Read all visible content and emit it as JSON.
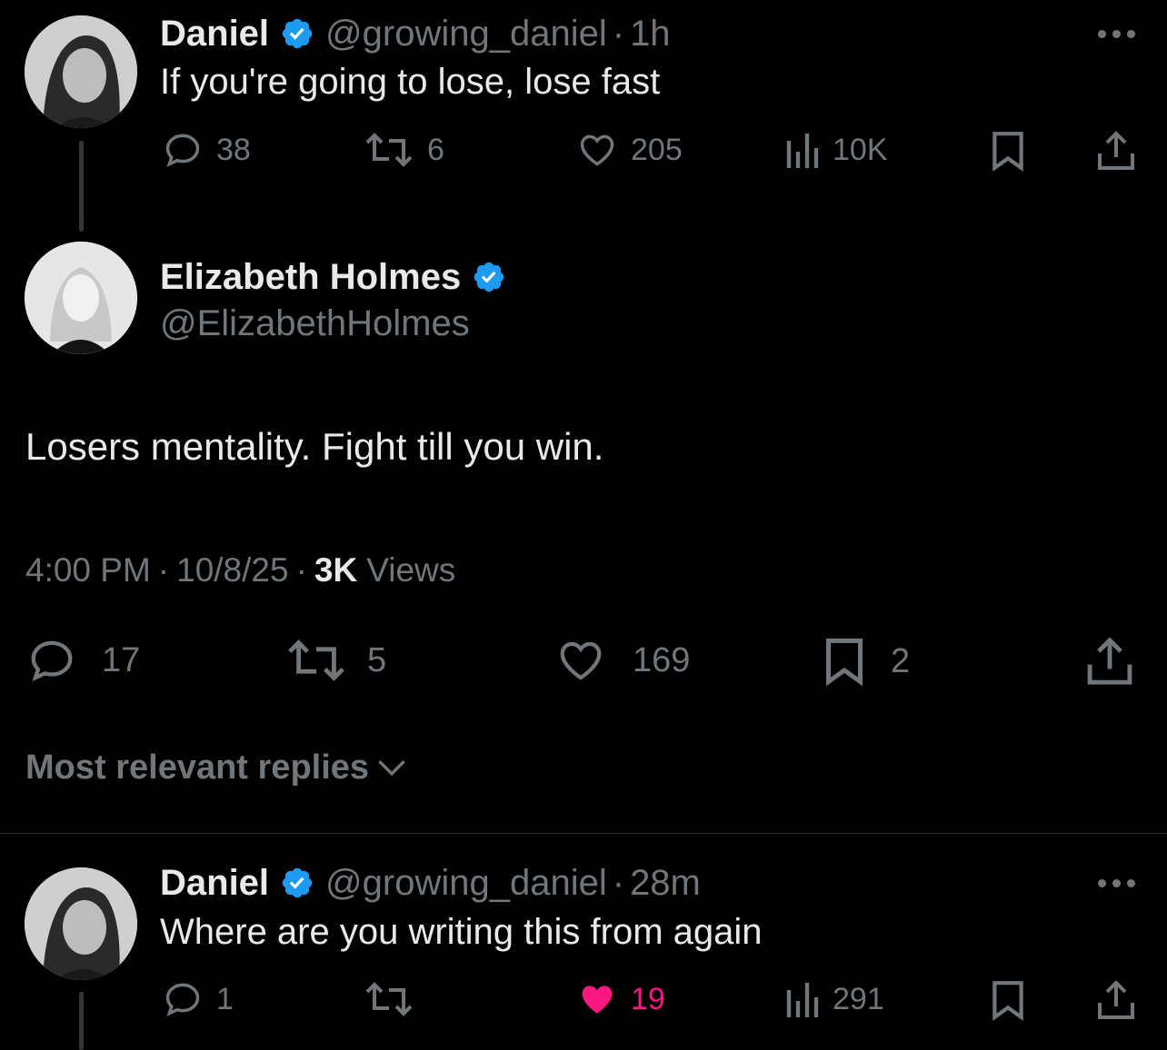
{
  "tweets": [
    {
      "name": "Daniel",
      "handle": "@growing_daniel",
      "sep": "·",
      "time": "1h",
      "text": "If you're going to lose, lose fast",
      "replies": "38",
      "retweets": "6",
      "likes": "205",
      "views": "10K"
    },
    {
      "name": "Elizabeth Holmes",
      "handle": "@ElizabethHolmes",
      "text": "Losers mentality. Fight till you win.",
      "time": "4:00 PM",
      "sep1": "·",
      "date": "10/8/25",
      "sep2": "·",
      "views_count": "3K",
      "views_label": "Views",
      "replies": "17",
      "retweets": "5",
      "likes": "169",
      "bookmarks": "2"
    },
    {
      "name": "Daniel",
      "handle": "@growing_daniel",
      "sep": "·",
      "time": "28m",
      "text": "Where are you writing this from again",
      "replies": "1",
      "retweets": "",
      "likes": "19",
      "liked": true,
      "views": "291"
    }
  ],
  "replies_filter": {
    "label": "Most relevant replies",
    "icon": "chevron-down-icon"
  },
  "colors": {
    "background": "#000000",
    "text": "#e7e9ea",
    "muted": "#71767b",
    "verified": "#1d9bf0",
    "like_active": "#f91880"
  }
}
